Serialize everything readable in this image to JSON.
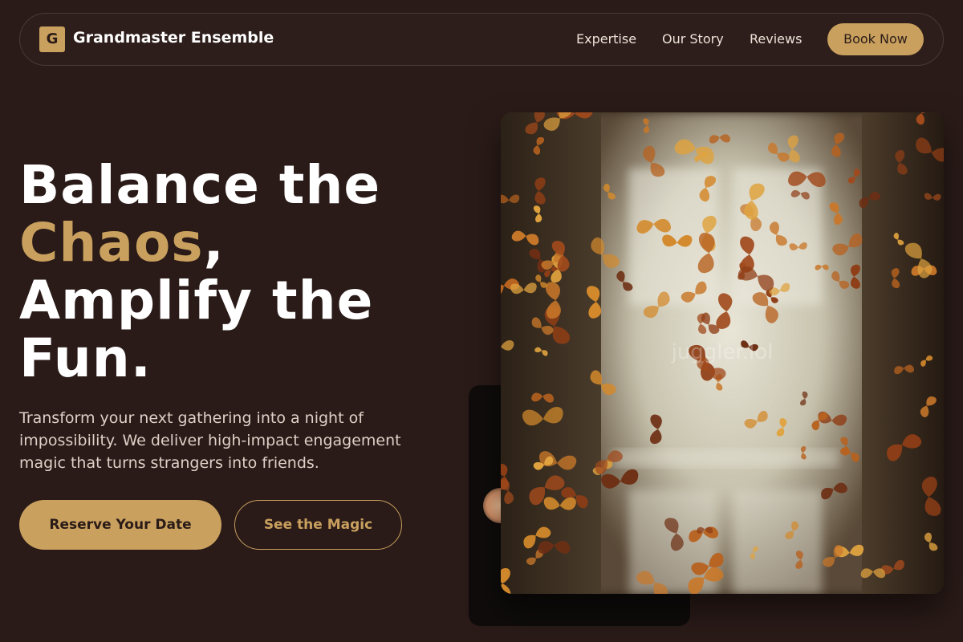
{
  "nav": {
    "logo_letter": "G",
    "brand": "Grandmaster Ensemble",
    "links": [
      "Expertise",
      "Our Story",
      "Reviews"
    ],
    "cta": "Book Now"
  },
  "hero": {
    "headline_line1": "Balance the",
    "headline_accent": "Chaos",
    "headline_comma": ",",
    "headline_line3": "Amplify the",
    "headline_line4": "Fun.",
    "subtext": "Transform your next gathering into a night of impossibility. We deliver high-impact engagement magic that turns strangers into friends.",
    "primary_button": "Reserve Your Date",
    "secondary_button": "See the Magic"
  },
  "media": {
    "photo_subject": "butterflies-in-doorway",
    "watermark": "juggler.lol"
  },
  "colors": {
    "background": "#2a1b18",
    "accent": "#c9a05e",
    "text": "#ffffff",
    "muted_text": "#ddd1c7"
  }
}
